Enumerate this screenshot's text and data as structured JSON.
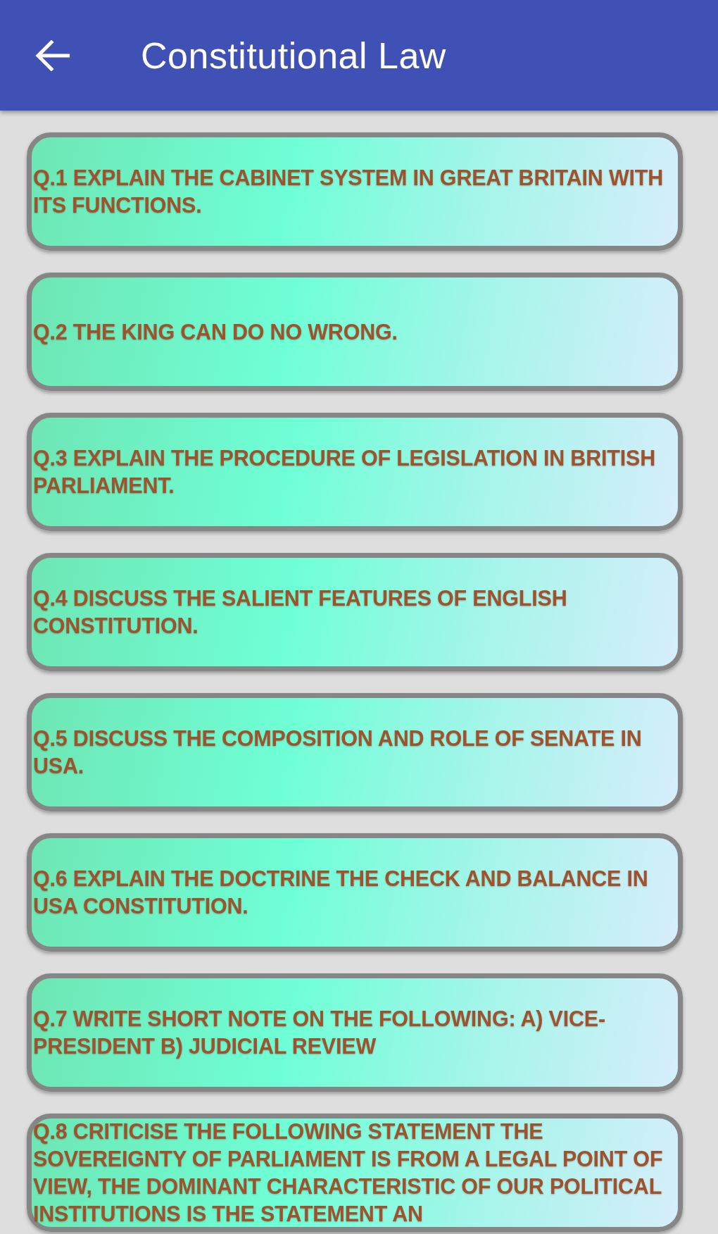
{
  "app_bar": {
    "title": "Constitutional Law"
  },
  "questions": [
    {
      "text": "Q.1 EXPLAIN THE CABINET SYSTEM IN GREAT BRITAIN WITH ITS FUNCTIONS."
    },
    {
      "text": "Q.2 THE KING CAN DO NO WRONG."
    },
    {
      "text": "Q.3 EXPLAIN THE PROCEDURE OF LEGISLATION IN BRITISH PARLIAMENT."
    },
    {
      "text": "Q.4 DISCUSS THE SALIENT FEATURES OF ENGLISH CONSTITUTION."
    },
    {
      "text": "Q.5 DISCUSS THE COMPOSITION AND ROLE OF SENATE IN USA."
    },
    {
      "text": "Q.6 EXPLAIN THE DOCTRINE THE CHECK AND BALANCE IN USA CONSTITUTION."
    },
    {
      "text": "Q.7 WRITE SHORT NOTE ON THE FOLLOWING: A) VICE-PRESIDENT B) JUDICIAL REVIEW"
    },
    {
      "text": "Q.8 CRITICISE THE FOLLOWING STATEMENT THE SOVEREIGNTY OF PARLIAMENT IS FROM A LEGAL POINT OF VIEW, THE DOMINANT CHARACTERISTIC OF OUR POLITICAL INSTITUTIONS IS THE STATEMENT AN"
    }
  ]
}
